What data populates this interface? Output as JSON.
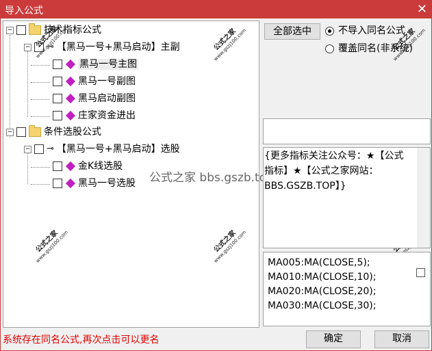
{
  "window": {
    "title": "导入公式",
    "close_glyph": "✕"
  },
  "tree": {
    "group1": {
      "label": "技术指标公式",
      "sub": "【黑马一号+黑马启动】主副",
      "items": [
        "黑马一号主图",
        "黑马一号副图",
        "黑马启动副图",
        "庄家资金进出"
      ]
    },
    "group2": {
      "label": "条件选股公式",
      "sub": "【黑马一号+黑马启动】选股",
      "items": [
        "金K线选股",
        "黑马一号选股"
      ]
    }
  },
  "watermark": {
    "text": "公式之家",
    "url": "www.gszj100.com",
    "center": "公式之家 bbs.gszb.top"
  },
  "controls": {
    "select_all": "全部选中",
    "radio_no_import": "不导入同名公式",
    "radio_overwrite": "覆盖同名(非系统)"
  },
  "description": "{更多指标关注公众号：★【公式指标】★【公式之家网站：BBS.GSZB.TOP】}",
  "code_lines": [
    "MA005:MA(CLOSE,5);",
    "MA010:MA(CLOSE,10);",
    "MA020:MA(CLOSE,20);",
    "MA030:MA(CLOSE,30);"
  ],
  "status": "系统存在同名公式,再次点击可以更名",
  "buttons": {
    "ok": "确定",
    "cancel": "取消"
  }
}
